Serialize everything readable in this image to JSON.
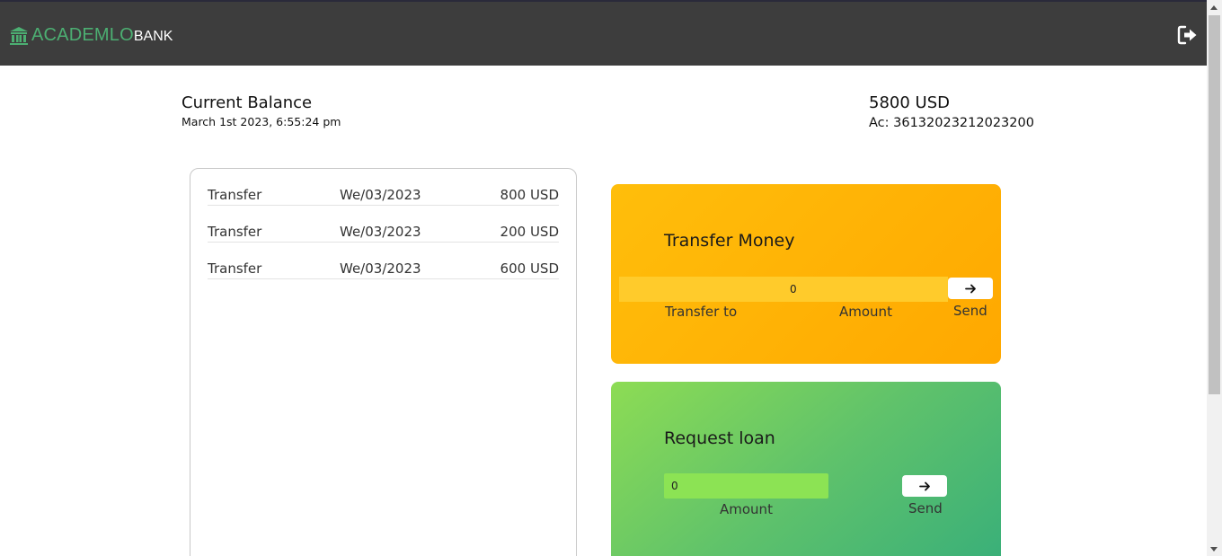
{
  "header": {
    "logo_primary": "ACADEMLO",
    "logo_secondary": "BANK",
    "logo_icon": "bank-icon",
    "logout_icon": "sign-out-icon"
  },
  "balance": {
    "title": "Current Balance",
    "date": "March 1st 2023, 6:55:24 pm",
    "amount": "5800 USD",
    "account": "Ac: 36132023212023200"
  },
  "movements": [
    {
      "type": "Transfer",
      "date": "We/03/2023",
      "amount": "800 USD"
    },
    {
      "type": "Transfer",
      "date": "We/03/2023",
      "amount": "200 USD"
    },
    {
      "type": "Transfer",
      "date": "We/03/2023",
      "amount": "600 USD"
    }
  ],
  "transfer": {
    "title": "Transfer Money",
    "to_value": "",
    "amount_value": "0",
    "to_label": "Transfer to",
    "amount_label": "Amount",
    "send_label": "Send",
    "send_icon": "arrow-right-icon"
  },
  "loan": {
    "title": "Request loan",
    "amount_value": "0",
    "amount_label": "Amount",
    "send_label": "Send",
    "send_icon": "arrow-right-icon"
  },
  "colors": {
    "topbar": "#3d3d3d",
    "brand_green": "#4caf72",
    "transfer_card": "#ffb300",
    "loan_card": "#5fc26b"
  }
}
